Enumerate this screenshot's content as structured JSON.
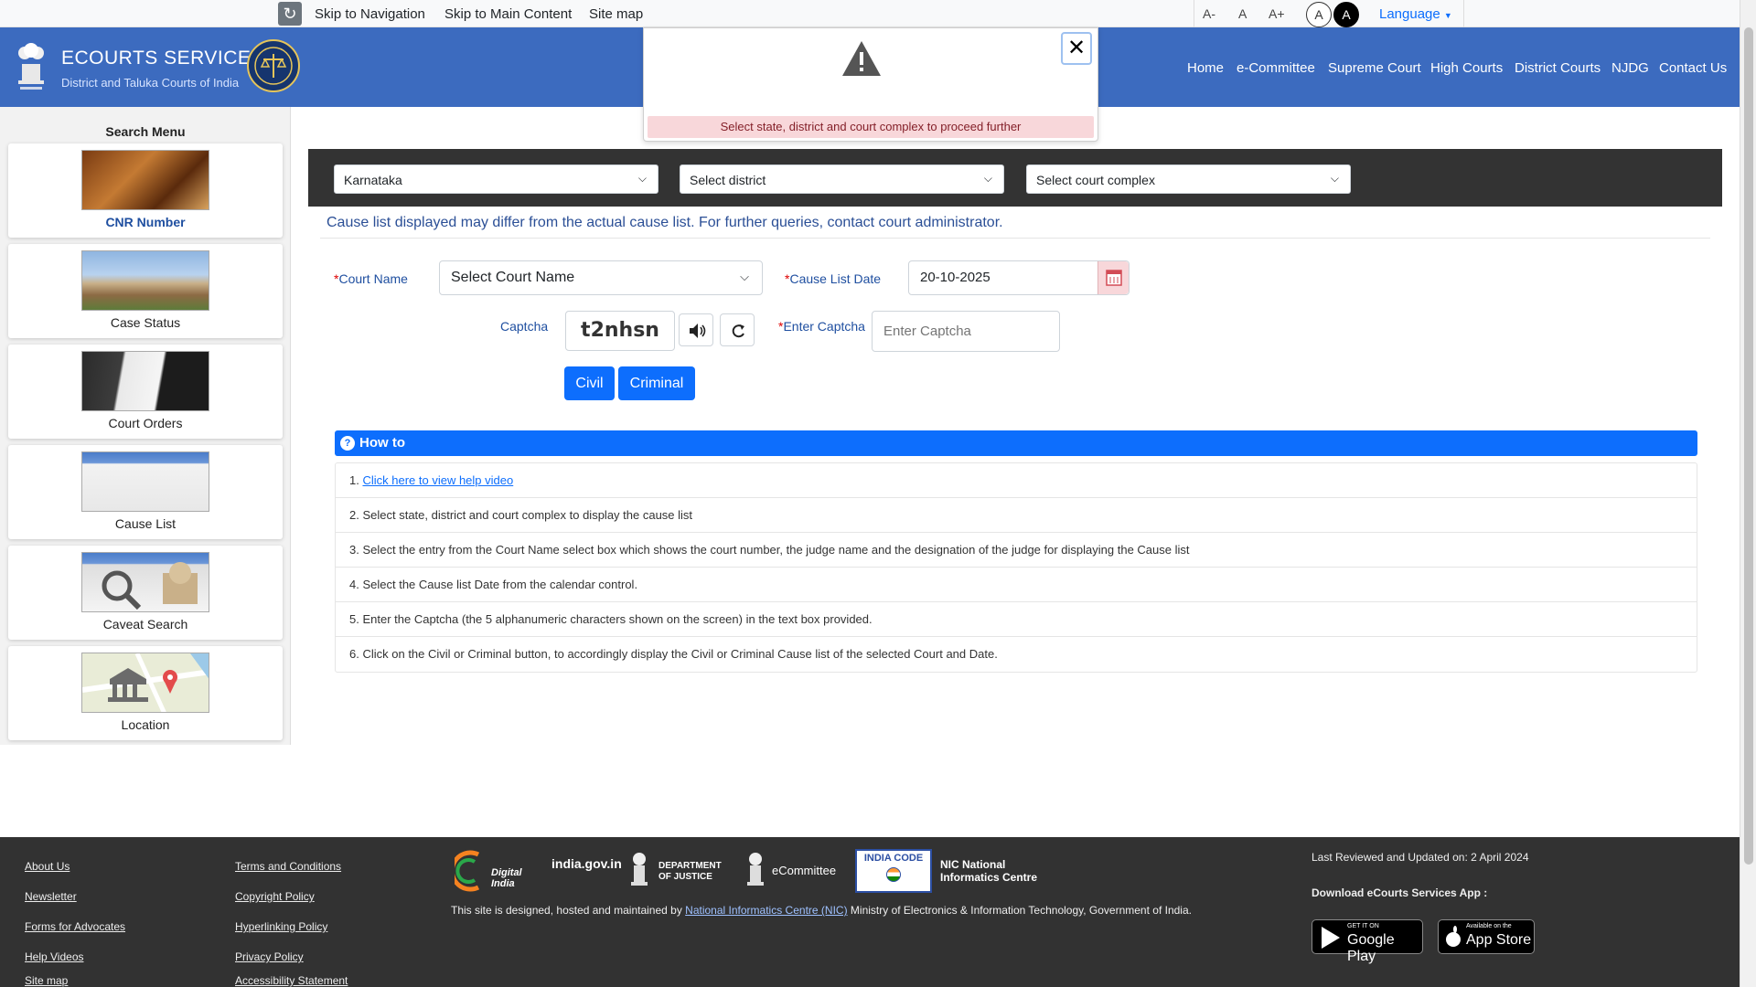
{
  "topbar": {
    "skip_nav": "Skip to Navigation",
    "skip_main": "Skip to Main Content",
    "sitemap": "Site map",
    "font_dec": "A-",
    "font_normal": "A",
    "font_inc": "A+",
    "contrast_light": "A",
    "contrast_dark": "A",
    "language": "Language"
  },
  "header": {
    "title": "ECOURTS SERVICES",
    "subtitle": "District and Taluka Courts of India",
    "nav": [
      "Home",
      "e-Committee",
      "Supreme Court",
      "High Courts",
      "District Courts",
      "NJDG",
      "Contact Us"
    ]
  },
  "modal": {
    "message": "Select state, district and court complex to proceed further"
  },
  "sidebar": {
    "title": "Search Menu",
    "items": [
      {
        "label": "CNR Number"
      },
      {
        "label": "Case Status"
      },
      {
        "label": "Court Orders"
      },
      {
        "label": "Cause List"
      },
      {
        "label": "Caveat Search"
      },
      {
        "label": "Location"
      }
    ]
  },
  "selectors": {
    "state": "Karnataka",
    "district": "Select district",
    "complex": "Select court complex"
  },
  "notice": "Cause list displayed may differ from the actual cause list. For further queries, contact court administrator.",
  "form": {
    "court_name_label": "Court Name",
    "court_name_value": "Select Court Name",
    "date_label": "Cause List Date",
    "date_value": "20-10-2025",
    "captcha_label": "Captcha",
    "captcha_text": "t2nhsn",
    "enter_captcha_label": "Enter Captcha",
    "enter_captcha_placeholder": "Enter Captcha",
    "civil": "Civil",
    "criminal": "Criminal",
    "required_mark": "*"
  },
  "howto": {
    "title": "How to",
    "items": [
      {
        "num": "1.",
        "text": "Click here to view help video"
      },
      {
        "num": "2.",
        "text": "Select state, district and court complex to display the cause list"
      },
      {
        "num": "3.",
        "text": "Select the entry from the Court Name select box which shows the court number, the judge name and the designation of the judge for displaying the Cause list"
      },
      {
        "num": "4.",
        "text": "Select the Cause list Date from the calendar control."
      },
      {
        "num": "5.",
        "text": "Enter the Captcha (the 5 alphanumeric characters shown on the screen) in the text box provided."
      },
      {
        "num": "6.",
        "text": "Click on the Civil or Criminal button, to accordingly display the Civil or Criminal Cause list of the selected Court and Date."
      }
    ]
  },
  "footer": {
    "col1": [
      "About Us",
      "Newsletter",
      "Forms for Advocates",
      "Help Videos",
      "Site map"
    ],
    "col2": [
      "Terms and Conditions",
      "Copyright Policy",
      "Hyperlinking Policy",
      "Privacy Policy",
      "Accessibility Statement"
    ],
    "logos": [
      "Digital India",
      "india.gov.in",
      "DEPARTMENT OF JUSTICE",
      "eCommittee",
      "INDIA CODE",
      "NIC National Informatics Centre"
    ],
    "hosted_prefix": "This site is designed, hosted and maintained by",
    "hosted_link": "National Informatics Centre (NIC)",
    "hosted_suffix": "Ministry of Electronics & Information Technology, Government of India.",
    "updated": "Last Reviewed and Updated on: 2 April 2024",
    "download": "Download eCourts Services App :",
    "google_play_small": "GET IT ON",
    "google_play": "Google Play",
    "app_store_small": "Available on the",
    "app_store": "App Store"
  },
  "colors": {
    "header_blue": "#3c6bbf",
    "primary": "#0d6efd",
    "footer_bg": "#323232",
    "alert_bg": "#f8d7da"
  }
}
